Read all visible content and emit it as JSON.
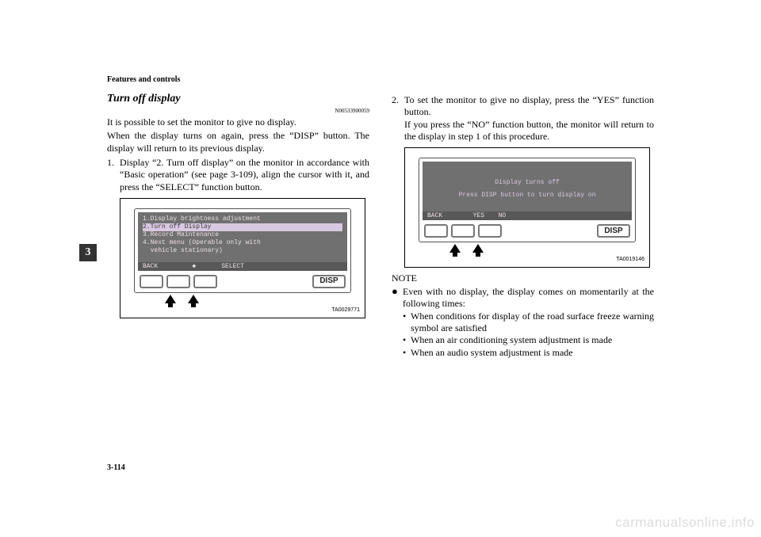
{
  "header": "Features and controls",
  "side_tab": "3",
  "page_num": "3-114",
  "watermark": "carmanualsonline.info",
  "left": {
    "subheading": "Turn off display",
    "doc_id": "N00533900059",
    "para1": "It is possible to set the monitor to give no display.",
    "para2": "When the display turns on again, press the “DISP” button. The display will return to its previous display.",
    "step1_num": "1.",
    "step1_text": "Display “2. Turn off display” on the monitor in accordance with “Basic operation” (see page 3-109), align the cursor with it, and press the “SELECT” function button.",
    "fig": {
      "id": "TA0029771",
      "row1": "1.Display brightness adjustment",
      "row2": "2.Turn off Display",
      "row3": "3.Record Maintenance",
      "row4": "4.Next menu (Operable only with",
      "row5": "  vehicle stationary)",
      "soft_back": "BACK",
      "soft_mid": "◆",
      "soft_select": "SELECT",
      "disp": "DISP"
    }
  },
  "right": {
    "step2_num": "2.",
    "step2_text_a": "To set the monitor to give no display, press the “YES” function button.",
    "step2_text_b": "If you press the “NO” function button, the monitor will return to the display in step 1 of this procedure.",
    "fig": {
      "id": "TA0019146",
      "line1": "Display turns off",
      "line2": "Press DISP button to turn display on",
      "soft_back": "BACK",
      "soft_yes": "YES",
      "soft_no": "NO",
      "disp": "DISP"
    },
    "note_heading": "NOTE",
    "note_bullet": "●",
    "note_text": "Even with no display, the display comes on momentarily at the following times:",
    "sub_bullet": "•",
    "sub1": "When conditions for display of the road surface freeze warning symbol are satisfied",
    "sub2": "When an air conditioning system adjustment is made",
    "sub3": "When an audio system adjustment is made"
  }
}
